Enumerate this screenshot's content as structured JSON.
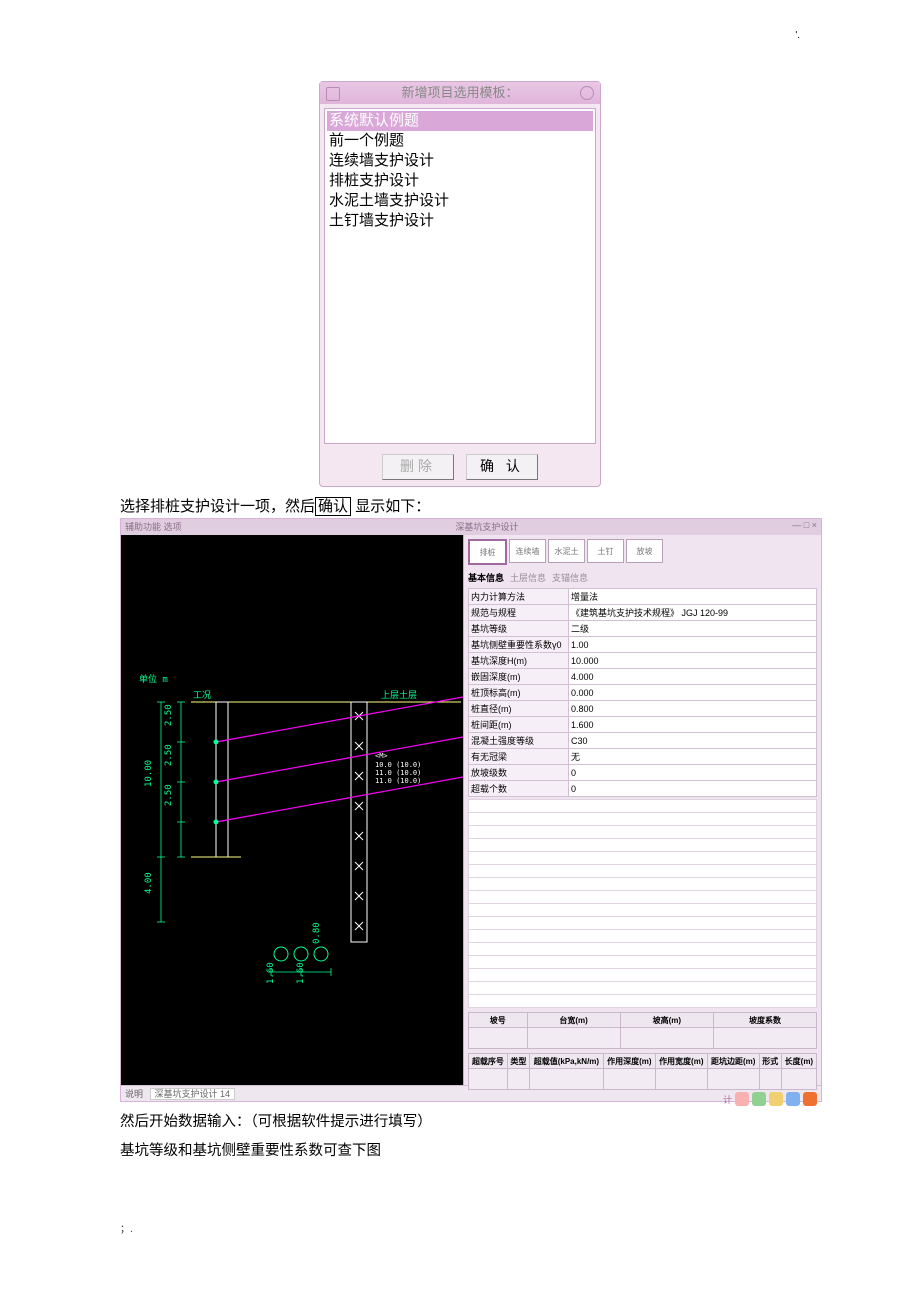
{
  "header_dot": "'.",
  "dialog": {
    "title": "新增项目选用模板：",
    "items": [
      "系统默认例题",
      "前一个例题",
      "连续墙支护设计",
      "排桩支护设计",
      "水泥土墙支护设计",
      "土钉墙支护设计"
    ],
    "btn_delete": "删除",
    "btn_ok": "确 认"
  },
  "caption1_pre": "选择排桩支护设计一项，然后",
  "caption1_box": "确认",
  "caption1_post": "  显示如下：",
  "app": {
    "menu_left": "辅助功能 选项",
    "window_title": "深基坑支护设计",
    "toolbar": [
      "排桩",
      "连续墙",
      "水泥土",
      "土钉",
      "放坡"
    ],
    "tabs": [
      "基本信息",
      "土层信息",
      "支锚信息"
    ],
    "props": [
      {
        "k": "内力计算方法",
        "v": "增量法"
      },
      {
        "k": "规范与规程",
        "v": "《建筑基坑支护技术规程》 JGJ 120-99"
      },
      {
        "k": "基坑等级",
        "v": "二级"
      },
      {
        "k": "基坑侧壁重要性系数γ0",
        "v": "1.00"
      },
      {
        "k": "基坑深度H(m)",
        "v": "10.000"
      },
      {
        "k": "嵌固深度(m)",
        "v": "4.000"
      },
      {
        "k": "桩顶标高(m)",
        "v": "0.000"
      },
      {
        "k": "桩直径(m)",
        "v": "0.800"
      },
      {
        "k": "桩间距(m)",
        "v": "1.600"
      },
      {
        "k": "混凝土强度等级",
        "v": "C30"
      },
      {
        "k": "有无冠梁",
        "v": "无"
      },
      {
        "k": "放坡级数",
        "v": "0"
      },
      {
        "k": "超载个数",
        "v": "0"
      }
    ],
    "subtable1_headers": [
      "坡号",
      "台宽(m)",
      "坡高(m)",
      "坡度系数"
    ],
    "subtable2_headers": [
      "超载序号",
      "类型",
      "超载值(kPa,kN/m)",
      "作用深度(m)",
      "作用宽度(m)",
      "距坑边距(m)",
      "形式",
      "长度(m)"
    ],
    "status_label": "说明",
    "status_text": "深基坑支护设计 14",
    "footer_label": "计",
    "drawing": {
      "unit_label": "单位  m",
      "top_label": "工况",
      "ground_label": "上层土层",
      "dims_v": [
        "2.50",
        "2.50",
        "2.50"
      ],
      "dim_H": "10.00",
      "dim_embed": "4.00",
      "dim_bottom": [
        "1.60",
        "1.60"
      ],
      "dim_pile": "0.80",
      "pile_section": [
        "<M>",
        "10.0 (10.0)",
        "11.0 (10.0)",
        "11.0 (10.0)"
      ]
    }
  },
  "bodytext1": "然后开始数据输入：（可根据软件提示进行填写）",
  "bodytext2": "基坑等级和基坑侧壁重要性系数可查下图",
  "pageft": "；."
}
